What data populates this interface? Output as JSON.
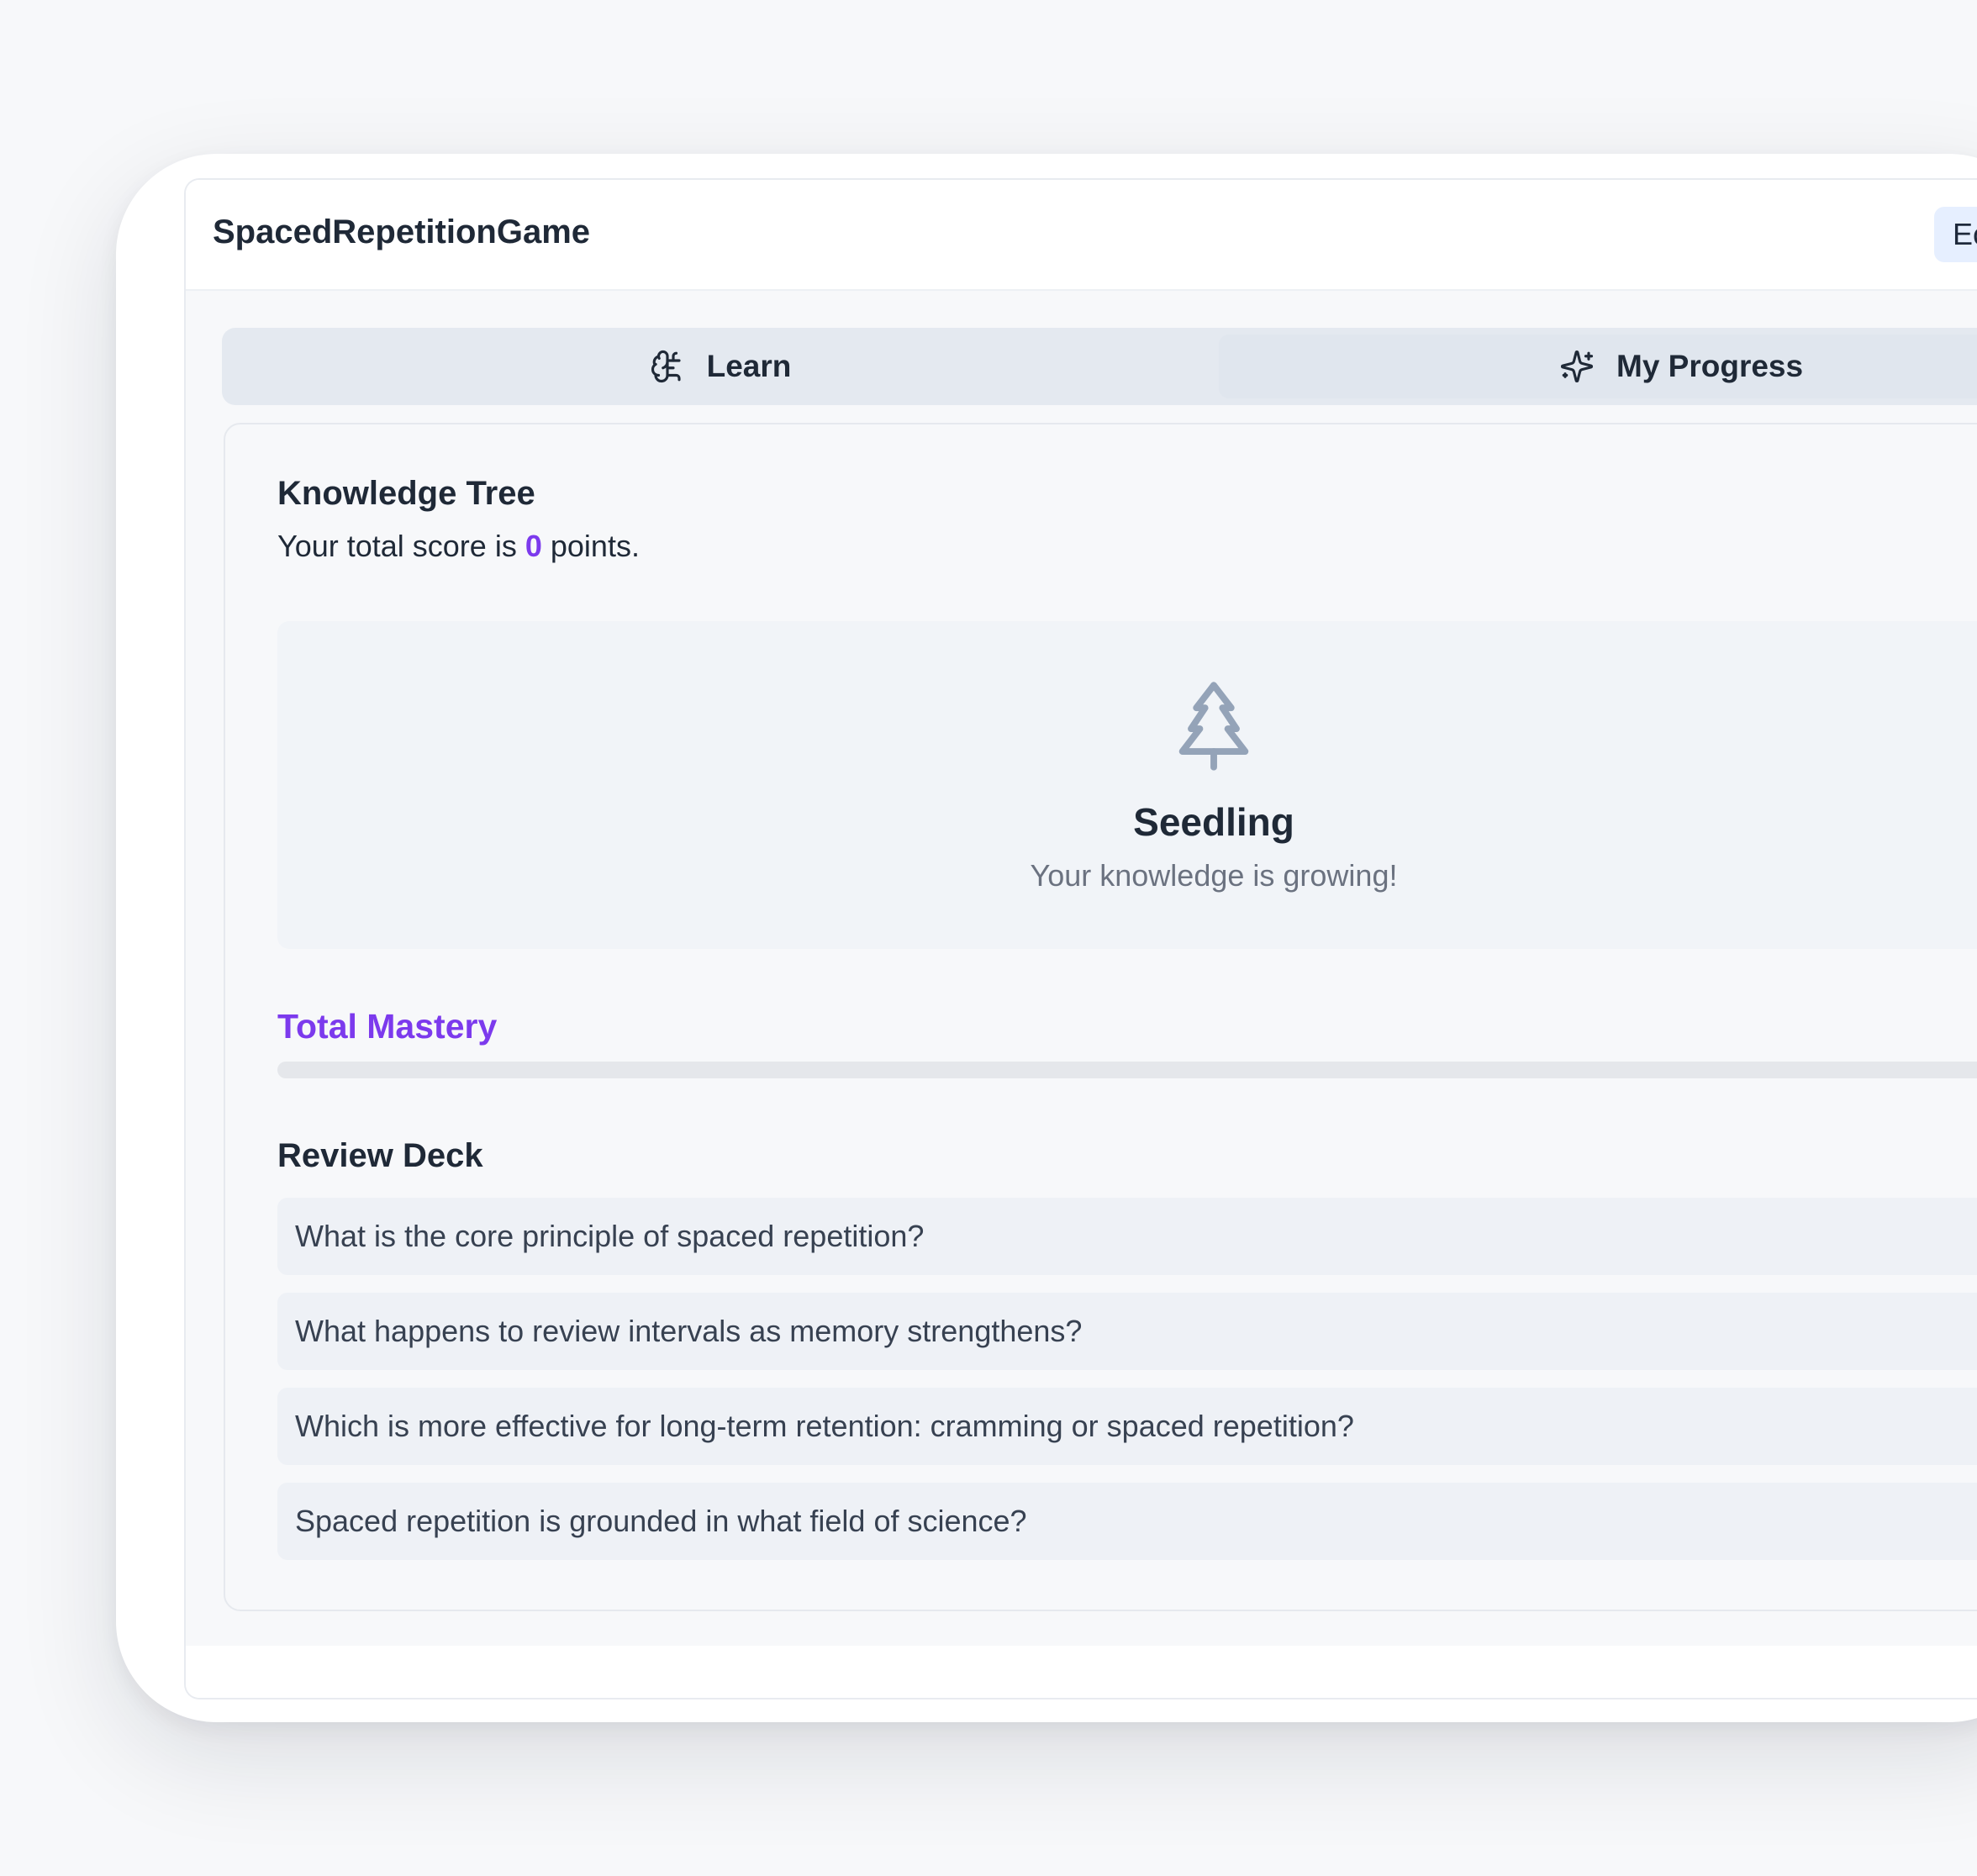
{
  "app": {
    "title": "SpacedRepetitionGame",
    "header_button_label": "Ec"
  },
  "tabs": [
    {
      "label": "Learn",
      "icon": "brain-icon"
    },
    {
      "label": "My Progress",
      "icon": "sparkles-icon"
    }
  ],
  "knowledge_tree": {
    "title": "Knowledge Tree",
    "score_prefix": "Your total score is",
    "score_value": "0",
    "score_suffix": "points.",
    "stage": {
      "icon": "tree-icon",
      "name": "Seedling",
      "description": "Your knowledge is growing!"
    }
  },
  "mastery": {
    "label": "Total Mastery",
    "progress_fraction": 0
  },
  "review_deck": {
    "title": "Review Deck",
    "items": [
      "What is the core principle of spaced repetition?",
      "What happens to review intervals as memory strengthens?",
      "Which is more effective for long-term retention: cramming or spaced repetition?",
      "Spaced repetition is grounded in what field of science?"
    ]
  },
  "colors": {
    "accent": "#7c3aed",
    "background": "#f7f8fa",
    "tab_bar": "#e4e9f0"
  }
}
